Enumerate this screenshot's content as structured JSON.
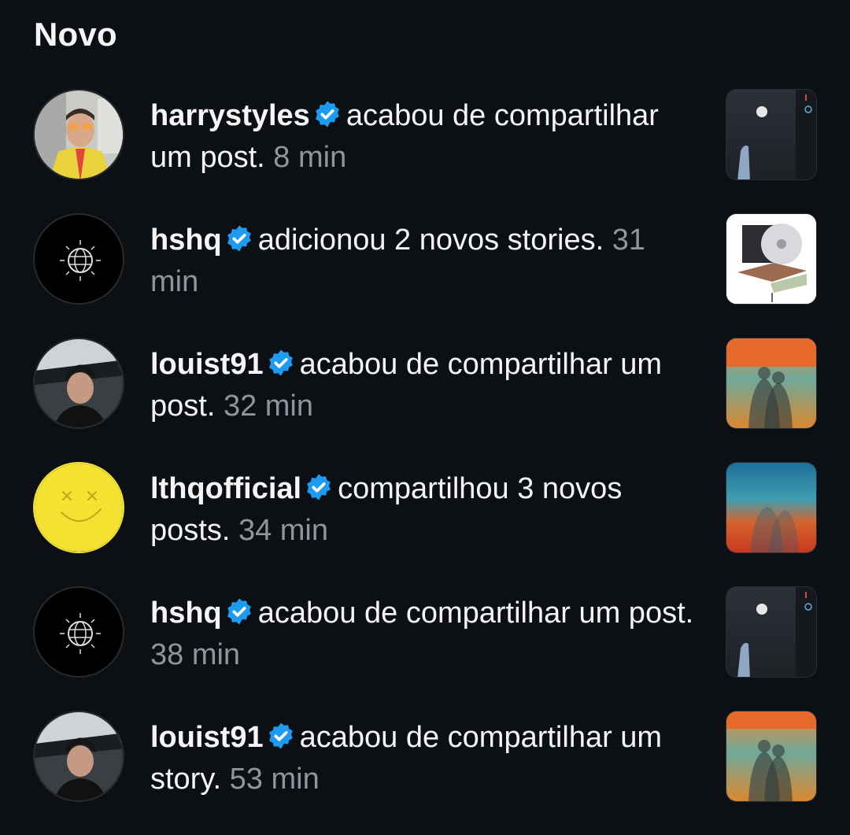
{
  "header": {
    "title": "Novo"
  },
  "notifications": [
    {
      "username": "harrystyles",
      "verified": true,
      "action": "acabou de compartilhar um post.",
      "time": "8 min",
      "avatar": "man-glasses",
      "thumb": "night-sky-disco"
    },
    {
      "username": "hshq",
      "verified": true,
      "action": "adicionou 2 novos stories.",
      "time": "31 min",
      "avatar": "globe-logo",
      "thumb": "vinyl-product"
    },
    {
      "username": "louist91",
      "verified": true,
      "action": "acabou de compartilhar um post.",
      "time": "32 min",
      "avatar": "man-car",
      "thumb": "imposter-cover"
    },
    {
      "username": "lthqofficial",
      "verified": true,
      "action": "compartilhou 3 novos posts.",
      "time": "34 min",
      "avatar": "smiley-yellow",
      "thumb": "gradient-figures"
    },
    {
      "username": "hshq",
      "verified": true,
      "action": "acabou de compartilhar um post.",
      "time": "38 min",
      "avatar": "globe-logo",
      "thumb": "night-sky-disco"
    },
    {
      "username": "louist91",
      "verified": true,
      "action": "acabou de compartilhar um story.",
      "time": "53 min",
      "avatar": "man-car",
      "thumb": "imposter-cover"
    }
  ],
  "colors": {
    "background": "#0c1014",
    "text": "#f5f5f5",
    "muted": "#8e959c",
    "verified": "#1d9bf0"
  }
}
